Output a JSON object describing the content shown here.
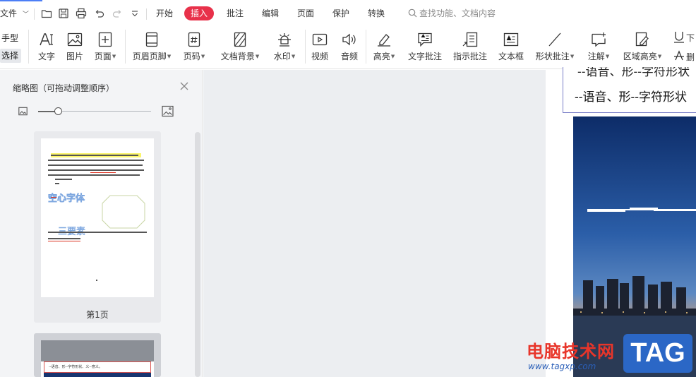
{
  "menubar": {
    "file_label": "文件",
    "tabs": [
      {
        "label": "开始"
      },
      {
        "label": "插入",
        "active": true
      },
      {
        "label": "批注"
      },
      {
        "label": "编辑"
      },
      {
        "label": "页面"
      },
      {
        "label": "保护"
      },
      {
        "label": "转换"
      }
    ],
    "search_placeholder": "查找功能、文档内容",
    "active_tab_color": "#e8314a"
  },
  "ribbon": {
    "mode_hand": "手型",
    "mode_select": "选择",
    "buttons": [
      {
        "label": "文字",
        "icon": "text-icon"
      },
      {
        "label": "图片",
        "icon": "image-icon"
      },
      {
        "label": "页面",
        "icon": "add-page-icon",
        "dropdown": true
      },
      {
        "label": "页眉页脚",
        "icon": "header-footer-icon",
        "dropdown": true
      },
      {
        "label": "页码",
        "icon": "page-number-icon",
        "dropdown": true
      },
      {
        "label": "文档背景",
        "icon": "background-icon",
        "dropdown": true
      },
      {
        "label": "水印",
        "icon": "watermark-icon",
        "dropdown": true
      },
      {
        "label": "视频",
        "icon": "video-icon"
      },
      {
        "label": "音频",
        "icon": "audio-icon"
      },
      {
        "label": "高亮",
        "icon": "highlight-icon",
        "dropdown": true
      },
      {
        "label": "文字批注",
        "icon": "text-comment-icon"
      },
      {
        "label": "指示批注",
        "icon": "pointer-comment-icon"
      },
      {
        "label": "文本框",
        "icon": "textbox-icon"
      },
      {
        "label": "形状批注",
        "icon": "shape-comment-icon",
        "dropdown": true
      },
      {
        "label": "注解",
        "icon": "annotation-icon",
        "dropdown": true
      },
      {
        "label": "区域高亮",
        "icon": "area-highlight-icon",
        "dropdown": true
      },
      {
        "label": "下",
        "icon": "underline-icon"
      },
      {
        "label": "删",
        "icon": "strikethrough-icon"
      }
    ]
  },
  "thumbnail_panel": {
    "title": "缩略图（可拖动调整顺序）",
    "zoom_fraction": 0.18,
    "pages": [
      {
        "label": "第1页",
        "hollow_text": "空心字体",
        "heading_text": "三要素"
      },
      {
        "label": "",
        "caption": "--语音、形--字符形状、义--意义。"
      }
    ]
  },
  "document": {
    "textbox_line1": "--语音、形--字符形状",
    "textbox_line2": "--语音、形--字符形状"
  },
  "watermark": {
    "site_name": "电脑技术网",
    "url": "www.tagxp.com",
    "tag": "TAG"
  }
}
